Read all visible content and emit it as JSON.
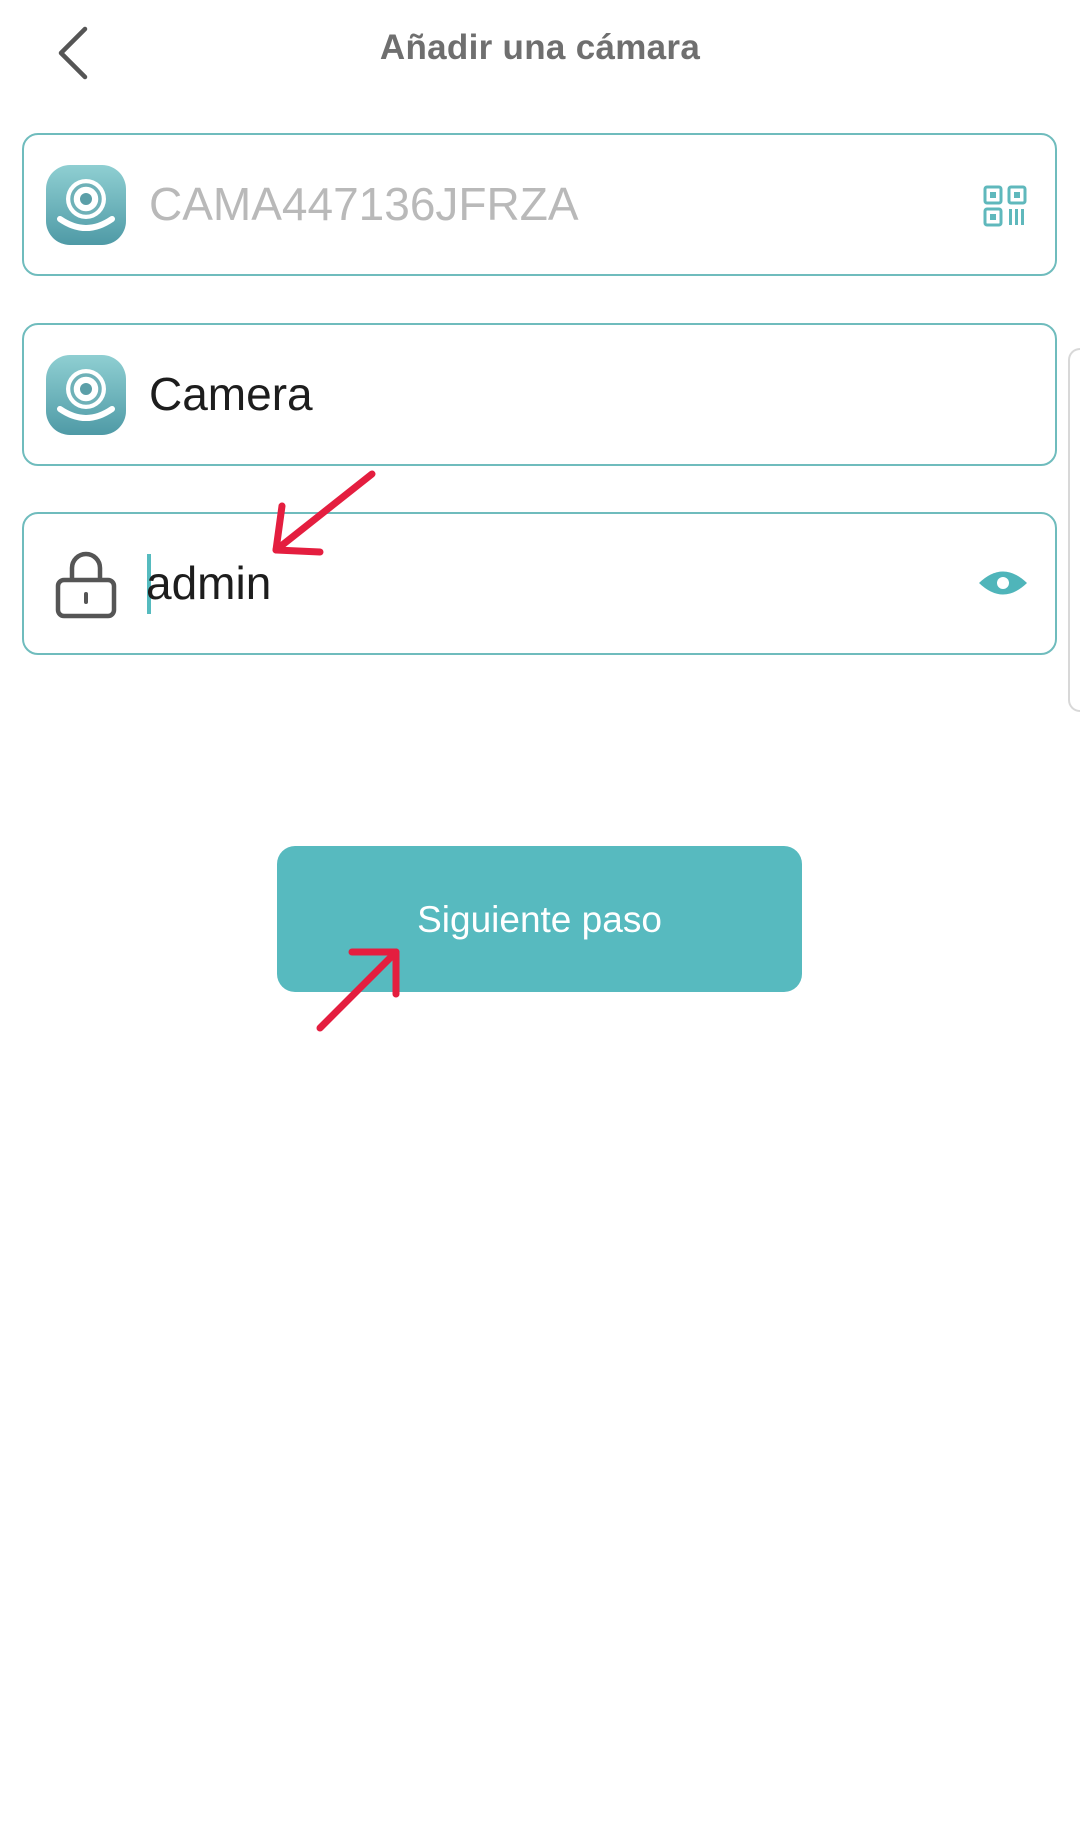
{
  "header": {
    "title": "Añadir una cámara",
    "back_icon": "chevron-left-icon"
  },
  "form": {
    "device_id": {
      "placeholder": "CAMA447136JFRZA",
      "icon": "camera-app-icon",
      "action_icon": "qr-code-icon"
    },
    "device_name": {
      "value": "Camera",
      "icon": "camera-app-icon"
    },
    "password": {
      "value": "admin",
      "icon": "lock-icon",
      "action_icon": "eye-icon"
    }
  },
  "actions": {
    "next_label": "Siguiente paso"
  },
  "colors": {
    "accent": "#57babf",
    "field_border": "#6fbcbd",
    "annotation_arrow": "#e41e3f",
    "title": "#6f6f6f"
  },
  "annotations": {
    "arrow_icon": "red-arrow-icon"
  }
}
